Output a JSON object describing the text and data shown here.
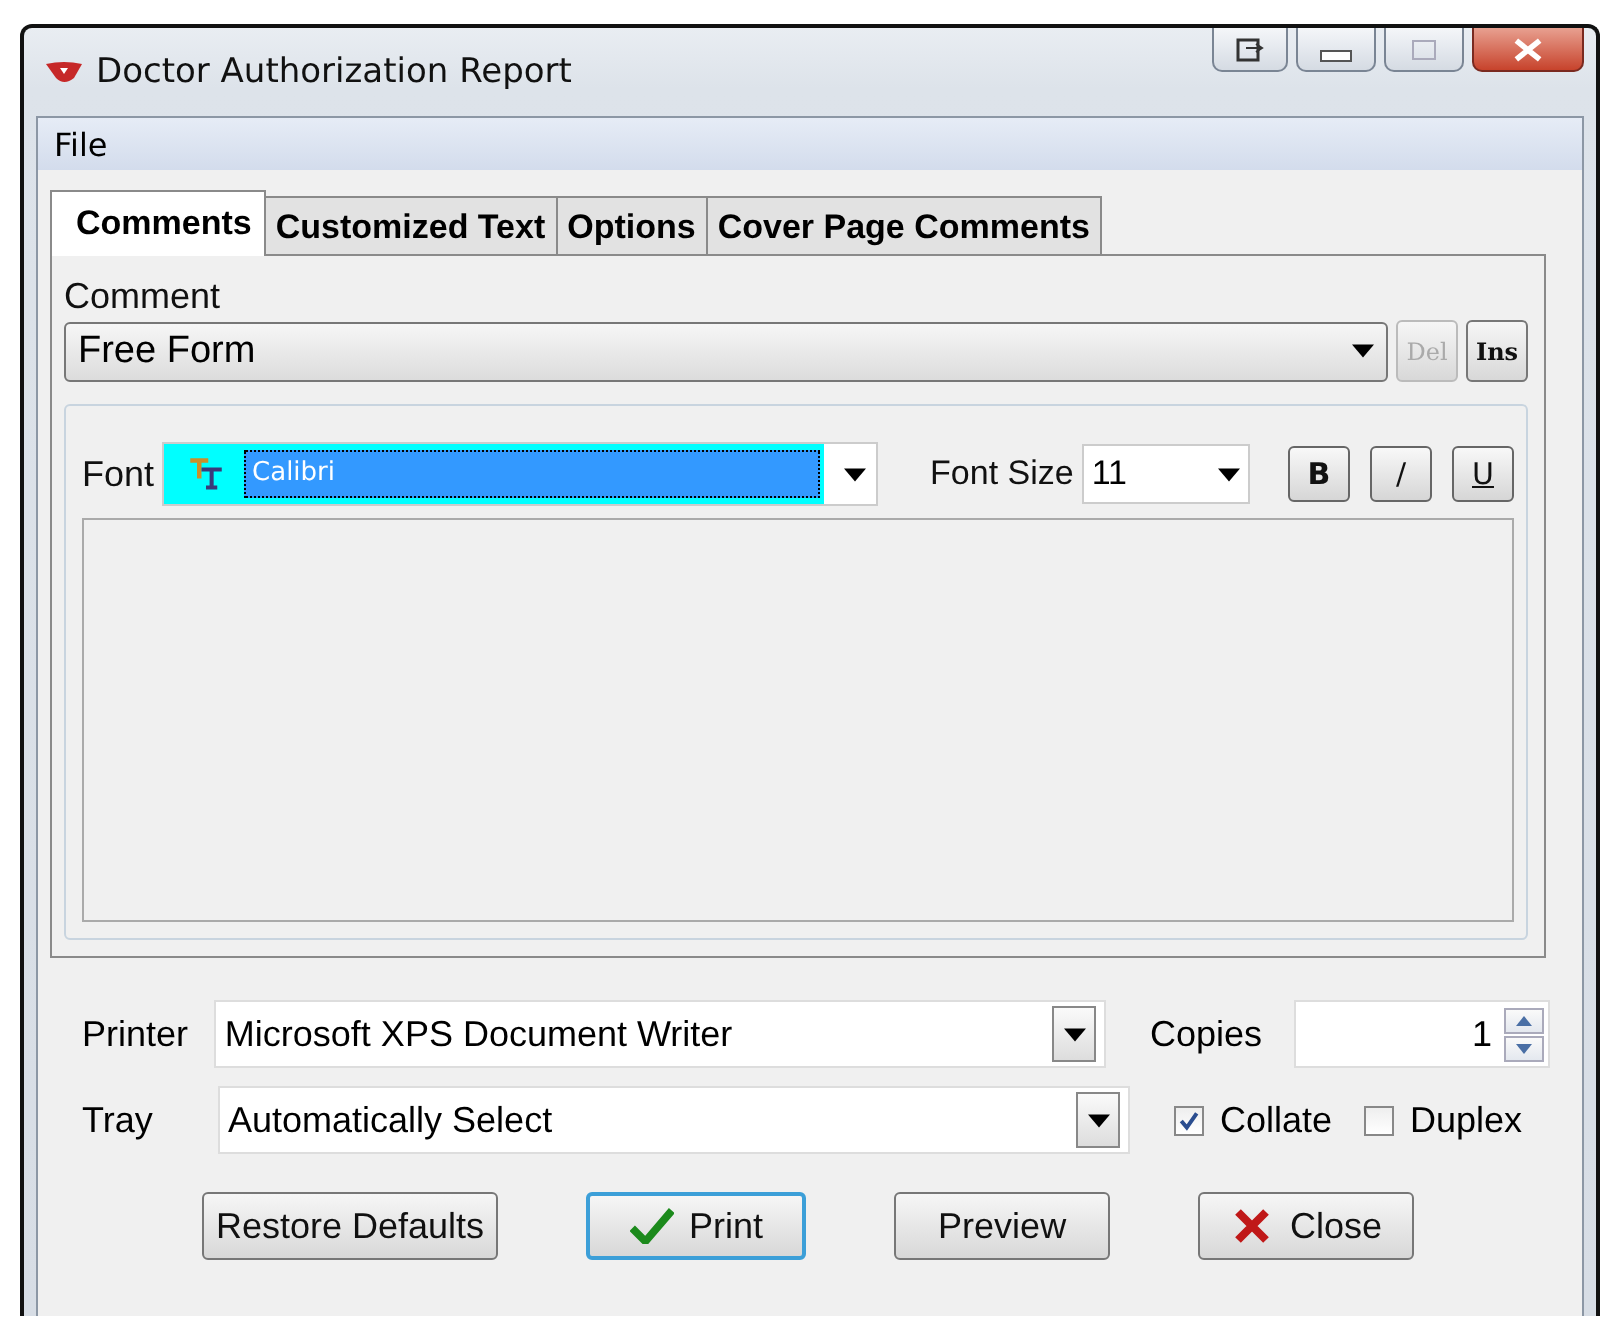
{
  "window": {
    "title": "Doctor Authorization Report"
  },
  "menu": [
    {
      "label": "File"
    }
  ],
  "tabs": [
    {
      "label": "Comments",
      "selected": true
    },
    {
      "label": "Customized Text",
      "selected": false
    },
    {
      "label": "Options",
      "selected": false
    },
    {
      "label": "Cover Page Comments",
      "selected": false
    }
  ],
  "comment": {
    "label": "Comment",
    "value": "Free Form",
    "buttons": [
      {
        "label": "Del",
        "disabled": true
      },
      {
        "label": "Ins",
        "disabled": false
      }
    ]
  },
  "font": {
    "label": "Font",
    "value": "Calibri",
    "size_label": "Font Size",
    "size": "11",
    "style_buttons": [
      {
        "label": "B",
        "kind": "bold"
      },
      {
        "label": "/",
        "kind": "plain"
      },
      {
        "label": "U",
        "kind": "underline"
      }
    ]
  },
  "printer": {
    "label": "Printer",
    "value": "Microsoft XPS Document Writer"
  },
  "tray": {
    "label": "Tray",
    "value": "Automatically Select"
  },
  "copies": {
    "label": "Copies",
    "value": "1"
  },
  "options": [
    {
      "label": "Collate",
      "checked": true
    },
    {
      "label": "Duplex",
      "checked": false
    }
  ],
  "buttons": [
    {
      "label": "Restore Defaults",
      "kind": "plain",
      "default": false
    },
    {
      "label": "Print",
      "kind": "confirm",
      "default": true
    },
    {
      "label": "Preview",
      "kind": "plain",
      "default": false
    },
    {
      "label": "Close",
      "kind": "cancel",
      "default": false
    }
  ]
}
